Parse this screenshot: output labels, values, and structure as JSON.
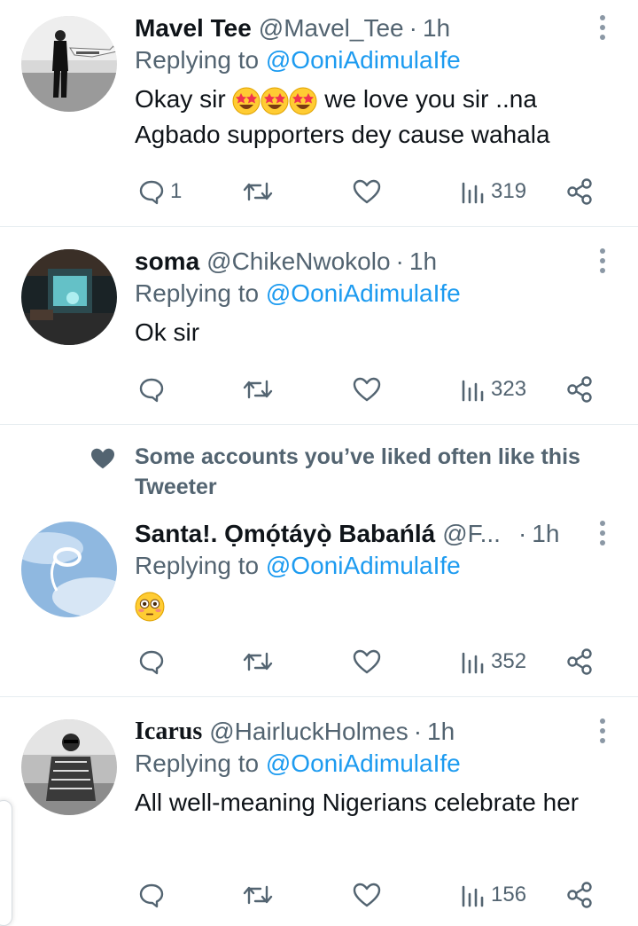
{
  "tweets": [
    {
      "name": "Mavel Tee",
      "handle": "@Mavel_Tee",
      "dot": "·",
      "time": "1h",
      "replying_prefix": "Replying to ",
      "replying_to": "@OoniAdimulaIfe",
      "text_a": "Okay sir ",
      "text_b": " we love you sir ..na Agbado supporters dey cause wahala",
      "emojis": [
        "star-struck",
        "star-struck",
        "star-struck"
      ],
      "reply_count": "1",
      "retweet_count": "",
      "like_count": "",
      "view_count": "319"
    },
    {
      "name": "soma",
      "handle": "@ChikeNwokolo",
      "dot": "·",
      "time": "1h",
      "replying_prefix": "Replying to ",
      "replying_to": "@OoniAdimulaIfe",
      "text": "Ok sir",
      "reply_count": "",
      "view_count": "323"
    },
    {
      "name": "Santa!. Ọmọ́táyọ̀ Babańlá",
      "handle": "@F...",
      "dot": "·",
      "time": "1h",
      "replying_prefix": "Replying to ",
      "replying_to": "@OoniAdimulaIfe",
      "emojis": [
        "flushed-face"
      ],
      "reply_count": "",
      "view_count": "352"
    },
    {
      "name": "Icarus",
      "handle": "@HairluckHolmes",
      "dot": "·",
      "time": "1h",
      "replying_prefix": "Replying to ",
      "replying_to": "@OoniAdimulaIfe",
      "text": "All well-meaning Nigerians celebrate her",
      "reply_count": "",
      "view_count": "156"
    }
  ],
  "suggestion": {
    "text": "Some accounts you’ve liked often like this Tweeter",
    "icon": "heart-icon"
  },
  "icons": {
    "reply": "reply-icon",
    "retweet": "retweet-icon",
    "like": "like-icon",
    "views": "views-icon",
    "share": "share-icon",
    "more": "more-icon"
  },
  "colors": {
    "text": "#0f1419",
    "secondary": "#536471",
    "link": "#1d9bf0",
    "divider": "#e6ecf0"
  }
}
